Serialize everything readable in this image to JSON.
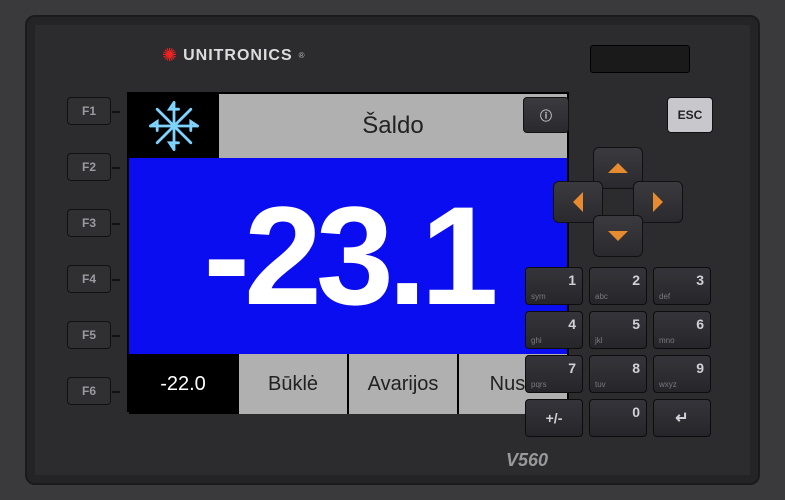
{
  "brand": {
    "name": "UNITRONICS",
    "model": "V560"
  },
  "fkeys": [
    "F1",
    "F2",
    "F3",
    "F4",
    "F5",
    "F6"
  ],
  "lcd": {
    "title": "Šaldo",
    "main_value": "-23.1",
    "setpoint": "-22.0",
    "footer": {
      "status": "Būklė",
      "alarms": "Avarijos",
      "settings": "Nust."
    },
    "icon": "snowflake-icon",
    "colors": {
      "main_bg": "#0a0df0",
      "panel": "#b0b0b0"
    }
  },
  "right_panel": {
    "info_label": "ⓘ",
    "esc_label": "ESC",
    "keypad": [
      {
        "digit": "1",
        "sub": "sym"
      },
      {
        "digit": "2",
        "sub": "abc"
      },
      {
        "digit": "3",
        "sub": "def"
      },
      {
        "digit": "4",
        "sub": "ghi"
      },
      {
        "digit": "5",
        "sub": "jkl"
      },
      {
        "digit": "6",
        "sub": "mno"
      },
      {
        "digit": "7",
        "sub": "pqrs"
      },
      {
        "digit": "8",
        "sub": "tuv"
      },
      {
        "digit": "9",
        "sub": "wxyz"
      },
      {
        "digit": "+/-",
        "sub": ""
      },
      {
        "digit": "0",
        "sub": ""
      },
      {
        "digit": "↵",
        "sub": ""
      }
    ]
  }
}
